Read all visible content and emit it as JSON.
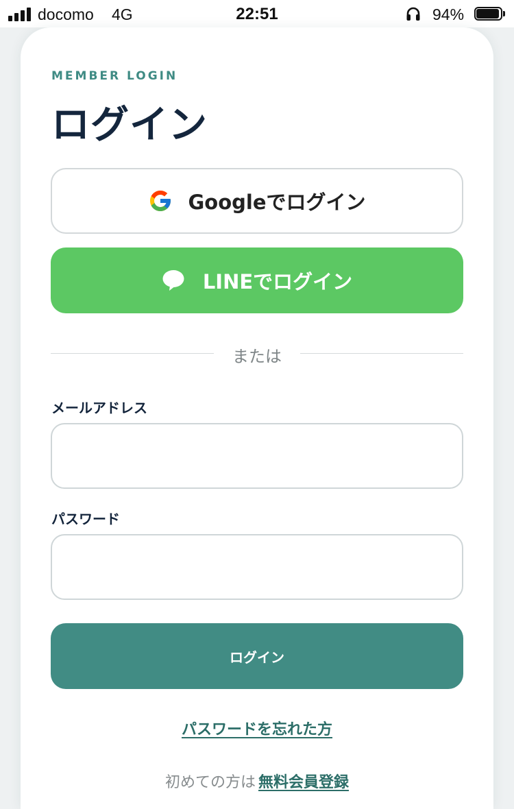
{
  "status_bar": {
    "carrier": "docomo",
    "network": "4G",
    "time": "22:51",
    "battery_percent": "94%",
    "battery_level": 0.94
  },
  "login": {
    "eyebrow": "MEMBER LOGIN",
    "title": "ログイン",
    "google_button_label": "Googleでログイン",
    "line_button_label": "LINEでログイン",
    "divider_text": "または",
    "email_label": "メールアドレス",
    "email_value": "",
    "password_label": "パスワード",
    "password_value": "",
    "submit_label": "ログイン",
    "forgot_password_link": "パスワードを忘れた方",
    "signup_prompt": "初めての方は",
    "signup_link": "無料会員登録"
  },
  "colors": {
    "accent": "#418c84",
    "link": "#2c6e68",
    "line_green": "#5cc863",
    "title": "#14263d"
  },
  "icons": {
    "google": "google-g-logo",
    "line": "speech-bubble",
    "status": [
      "cellular-signal",
      "headphones",
      "battery"
    ]
  }
}
